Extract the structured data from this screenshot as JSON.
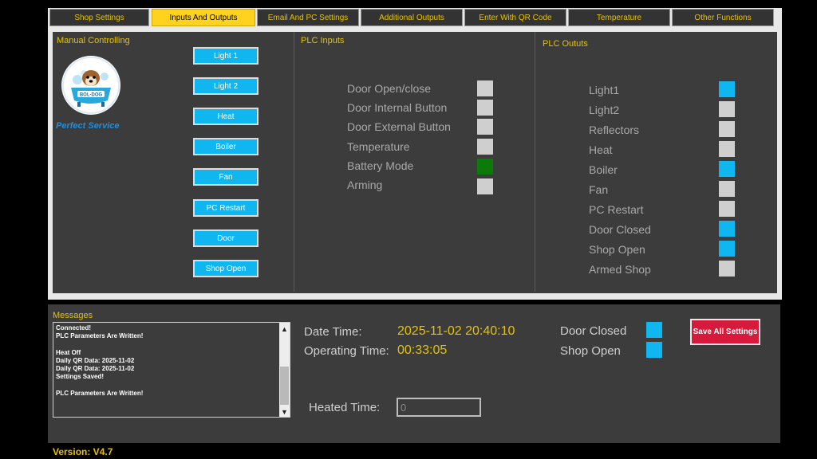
{
  "tabs": [
    {
      "label": "Shop Settings",
      "active": false
    },
    {
      "label": "Inputs And Outputs",
      "active": true
    },
    {
      "label": "Email And PC Settings",
      "active": false
    },
    {
      "label": "Additional Outputs",
      "active": false
    },
    {
      "label": "Enter With QR Code",
      "active": false
    },
    {
      "label": "Temperature",
      "active": false
    },
    {
      "label": "Other Functions",
      "active": false
    }
  ],
  "manual": {
    "title": "Manual Controlling",
    "slogan": "Perfect Service",
    "logo_text": "BOL-DOG",
    "buttons": [
      "Light 1",
      "Light 2",
      "Heat",
      "Boiler",
      "Fan",
      "PC Restart",
      "Door",
      "Shop Open"
    ]
  },
  "plc_inputs": {
    "title": "PLC Inputs",
    "items": [
      {
        "label": "Door Open/close",
        "state": "off"
      },
      {
        "label": "Door Internal Button",
        "state": "off"
      },
      {
        "label": "Door External Button",
        "state": "off"
      },
      {
        "label": "Temperature",
        "state": "off"
      },
      {
        "label": "Battery Mode",
        "state": "green"
      },
      {
        "label": "Arming",
        "state": "off"
      }
    ]
  },
  "plc_outputs": {
    "title": "PLC Oututs",
    "items": [
      {
        "label": "Light1",
        "state": "blue"
      },
      {
        "label": "Light2",
        "state": "off"
      },
      {
        "label": "Reflectors",
        "state": "off"
      },
      {
        "label": "Heat",
        "state": "off"
      },
      {
        "label": "Boiler",
        "state": "blue"
      },
      {
        "label": "Fan",
        "state": "off"
      },
      {
        "label": "PC Restart",
        "state": "off"
      },
      {
        "label": "Door Closed",
        "state": "blue"
      },
      {
        "label": "Shop Open",
        "state": "blue"
      },
      {
        "label": "Armed Shop",
        "state": "off"
      }
    ]
  },
  "messages": {
    "title": "Messages",
    "lines": [
      "Connected!",
      "PLC Parameters Are Written!",
      "",
      "Heat Off",
      "Daily QR Data: 2025-11-02",
      "Daily QR Data: 2025-11-02",
      "Settings Saved!",
      "",
      "PLC Parameters Are Written!"
    ]
  },
  "status": {
    "date_time_label": "Date  Time:",
    "date_time_value": "2025-11-02 20:40:10",
    "operating_time_label": "Operating Time:",
    "operating_time_value": "00:33:05",
    "door_closed_label": "Door Closed",
    "shop_open_label": "Shop Open",
    "heated_time_label": "Heated Time:",
    "heated_time_value": "0"
  },
  "save_button": "Save All Settings",
  "version": "Version: V4.7",
  "colors": {
    "accent_yellow": "#e6c200",
    "indicator_blue": "#10b6f0",
    "indicator_green": "#0b7a0b",
    "indicator_off": "#cfcfcf",
    "save_red": "#d61a3c"
  }
}
